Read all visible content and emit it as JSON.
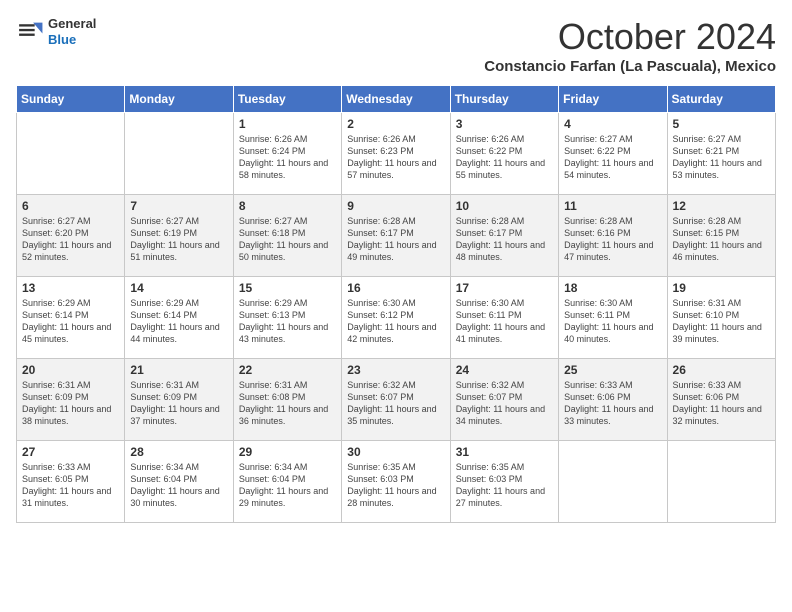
{
  "header": {
    "logo_line1": "General",
    "logo_line2": "Blue",
    "month": "October 2024",
    "location": "Constancio Farfan (La Pascuala), Mexico"
  },
  "days_of_week": [
    "Sunday",
    "Monday",
    "Tuesday",
    "Wednesday",
    "Thursday",
    "Friday",
    "Saturday"
  ],
  "weeks": [
    [
      {
        "day": "",
        "text": ""
      },
      {
        "day": "",
        "text": ""
      },
      {
        "day": "1",
        "text": "Sunrise: 6:26 AM\nSunset: 6:24 PM\nDaylight: 11 hours and 58 minutes."
      },
      {
        "day": "2",
        "text": "Sunrise: 6:26 AM\nSunset: 6:23 PM\nDaylight: 11 hours and 57 minutes."
      },
      {
        "day": "3",
        "text": "Sunrise: 6:26 AM\nSunset: 6:22 PM\nDaylight: 11 hours and 55 minutes."
      },
      {
        "day": "4",
        "text": "Sunrise: 6:27 AM\nSunset: 6:22 PM\nDaylight: 11 hours and 54 minutes."
      },
      {
        "day": "5",
        "text": "Sunrise: 6:27 AM\nSunset: 6:21 PM\nDaylight: 11 hours and 53 minutes."
      }
    ],
    [
      {
        "day": "6",
        "text": "Sunrise: 6:27 AM\nSunset: 6:20 PM\nDaylight: 11 hours and 52 minutes."
      },
      {
        "day": "7",
        "text": "Sunrise: 6:27 AM\nSunset: 6:19 PM\nDaylight: 11 hours and 51 minutes."
      },
      {
        "day": "8",
        "text": "Sunrise: 6:27 AM\nSunset: 6:18 PM\nDaylight: 11 hours and 50 minutes."
      },
      {
        "day": "9",
        "text": "Sunrise: 6:28 AM\nSunset: 6:17 PM\nDaylight: 11 hours and 49 minutes."
      },
      {
        "day": "10",
        "text": "Sunrise: 6:28 AM\nSunset: 6:17 PM\nDaylight: 11 hours and 48 minutes."
      },
      {
        "day": "11",
        "text": "Sunrise: 6:28 AM\nSunset: 6:16 PM\nDaylight: 11 hours and 47 minutes."
      },
      {
        "day": "12",
        "text": "Sunrise: 6:28 AM\nSunset: 6:15 PM\nDaylight: 11 hours and 46 minutes."
      }
    ],
    [
      {
        "day": "13",
        "text": "Sunrise: 6:29 AM\nSunset: 6:14 PM\nDaylight: 11 hours and 45 minutes."
      },
      {
        "day": "14",
        "text": "Sunrise: 6:29 AM\nSunset: 6:14 PM\nDaylight: 11 hours and 44 minutes."
      },
      {
        "day": "15",
        "text": "Sunrise: 6:29 AM\nSunset: 6:13 PM\nDaylight: 11 hours and 43 minutes."
      },
      {
        "day": "16",
        "text": "Sunrise: 6:30 AM\nSunset: 6:12 PM\nDaylight: 11 hours and 42 minutes."
      },
      {
        "day": "17",
        "text": "Sunrise: 6:30 AM\nSunset: 6:11 PM\nDaylight: 11 hours and 41 minutes."
      },
      {
        "day": "18",
        "text": "Sunrise: 6:30 AM\nSunset: 6:11 PM\nDaylight: 11 hours and 40 minutes."
      },
      {
        "day": "19",
        "text": "Sunrise: 6:31 AM\nSunset: 6:10 PM\nDaylight: 11 hours and 39 minutes."
      }
    ],
    [
      {
        "day": "20",
        "text": "Sunrise: 6:31 AM\nSunset: 6:09 PM\nDaylight: 11 hours and 38 minutes."
      },
      {
        "day": "21",
        "text": "Sunrise: 6:31 AM\nSunset: 6:09 PM\nDaylight: 11 hours and 37 minutes."
      },
      {
        "day": "22",
        "text": "Sunrise: 6:31 AM\nSunset: 6:08 PM\nDaylight: 11 hours and 36 minutes."
      },
      {
        "day": "23",
        "text": "Sunrise: 6:32 AM\nSunset: 6:07 PM\nDaylight: 11 hours and 35 minutes."
      },
      {
        "day": "24",
        "text": "Sunrise: 6:32 AM\nSunset: 6:07 PM\nDaylight: 11 hours and 34 minutes."
      },
      {
        "day": "25",
        "text": "Sunrise: 6:33 AM\nSunset: 6:06 PM\nDaylight: 11 hours and 33 minutes."
      },
      {
        "day": "26",
        "text": "Sunrise: 6:33 AM\nSunset: 6:06 PM\nDaylight: 11 hours and 32 minutes."
      }
    ],
    [
      {
        "day": "27",
        "text": "Sunrise: 6:33 AM\nSunset: 6:05 PM\nDaylight: 11 hours and 31 minutes."
      },
      {
        "day": "28",
        "text": "Sunrise: 6:34 AM\nSunset: 6:04 PM\nDaylight: 11 hours and 30 minutes."
      },
      {
        "day": "29",
        "text": "Sunrise: 6:34 AM\nSunset: 6:04 PM\nDaylight: 11 hours and 29 minutes."
      },
      {
        "day": "30",
        "text": "Sunrise: 6:35 AM\nSunset: 6:03 PM\nDaylight: 11 hours and 28 minutes."
      },
      {
        "day": "31",
        "text": "Sunrise: 6:35 AM\nSunset: 6:03 PM\nDaylight: 11 hours and 27 minutes."
      },
      {
        "day": "",
        "text": ""
      },
      {
        "day": "",
        "text": ""
      }
    ]
  ]
}
